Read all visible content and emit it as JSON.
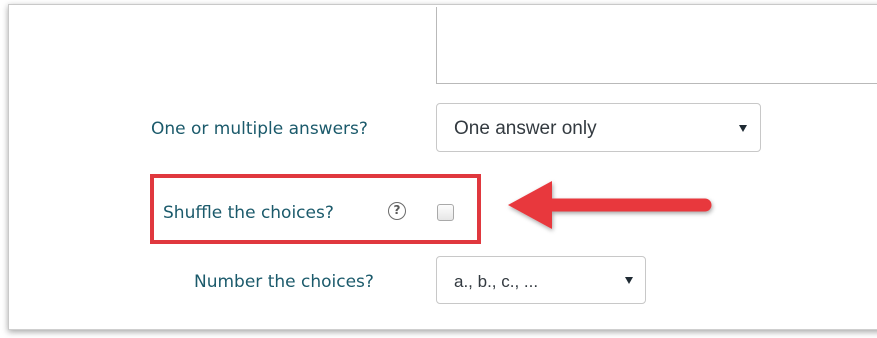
{
  "form": {
    "answers_label": "One or multiple answers?",
    "answers_select_value": "One answer only",
    "shuffle_label": "Shuffle the choices?",
    "shuffle_help_icon": "question-circle-icon",
    "shuffle_help_glyph": "?",
    "shuffle_checked": false,
    "numbering_label": "Number the choices?",
    "numbering_select_value": "a., b., c., ..."
  },
  "annotation": {
    "highlight_color": "#e0383e",
    "arrow_color": "#e8383e"
  },
  "colors": {
    "label_text": "#1b5a6b",
    "select_text": "#333a40"
  }
}
